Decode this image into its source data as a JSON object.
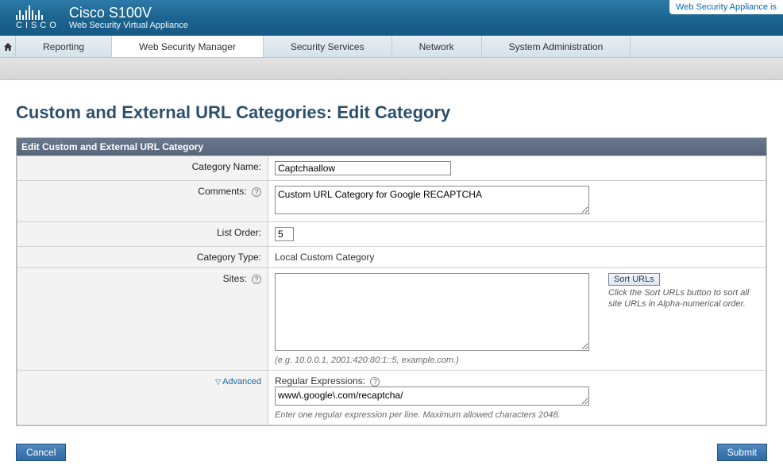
{
  "brand": {
    "logo_text": "CISCO",
    "product": "Cisco S100V",
    "subtitle": "Web Security Virtual Appliance"
  },
  "top_link": "Web Security Appliance is",
  "nav": {
    "tabs": [
      "Reporting",
      "Web Security Manager",
      "Security Services",
      "Network",
      "System Administration"
    ],
    "active_index": 1
  },
  "page": {
    "title": "Custom and External URL Categories: Edit Category"
  },
  "panel": {
    "header": "Edit Custom and External URL Category"
  },
  "form": {
    "category_name": {
      "label": "Category Name:",
      "value": "Captchaallow"
    },
    "comments": {
      "label": "Comments:",
      "value": "Custom URL Category for Google RECAPTCHA"
    },
    "list_order": {
      "label": "List Order:",
      "value": "5"
    },
    "category_type": {
      "label": "Category Type:",
      "value": "Local Custom Category"
    },
    "sites": {
      "label": "Sites:",
      "value": "",
      "hint": "(e.g. 10.0.0.1, 2001:420:80:1::5, example.com.)",
      "sort_button": "Sort URLs",
      "sort_hint": "Click the Sort URLs button to sort all site URLs in Alpha-numerical order."
    },
    "advanced": {
      "toggle": "Advanced",
      "regex_label": "Regular Expressions:",
      "regex_value": "www\\.google\\.com/recaptcha/",
      "regex_hint": "Enter one regular expression per line. Maximum allowed characters 2048."
    }
  },
  "buttons": {
    "cancel": "Cancel",
    "submit": "Submit"
  }
}
